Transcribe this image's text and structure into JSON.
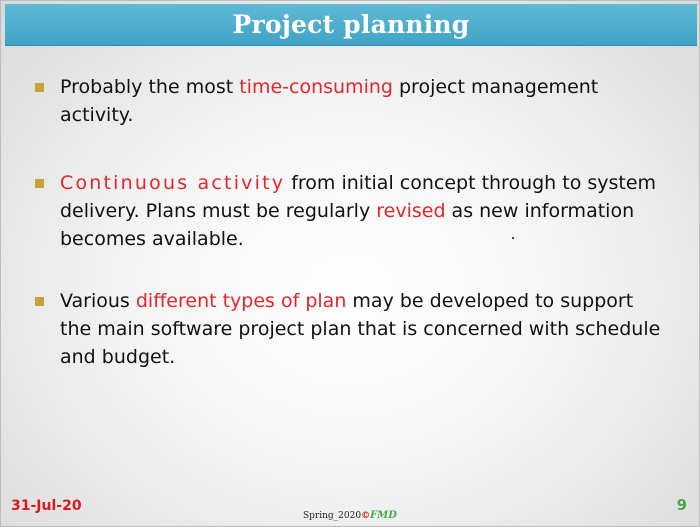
{
  "slide": {
    "title": "Project planning",
    "bullets": [
      {
        "parts": [
          "Probably the most ",
          "time-consuming",
          "  project management activity."
        ]
      },
      {
        "parts": [
          "Continuous activity",
          " from initial concept through to system delivery. Plans must be regularly ",
          "revised",
          " as new information becomes available."
        ]
      },
      {
        "parts": [
          "Various ",
          "different types of plan",
          " may be developed to support the main software project plan that is concerned with schedule and budget."
        ]
      }
    ]
  },
  "footer": {
    "date": "31-Jul-20",
    "term": "Spring_2020",
    "copyright_symbol": "©",
    "author": "FMD",
    "page_number": "9"
  },
  "colors": {
    "title_bar": "#45a9cb",
    "highlight": "#e3262b",
    "bullet_marker": "#c9a23a",
    "page_number": "#4aa84a",
    "date": "#d8191f"
  }
}
